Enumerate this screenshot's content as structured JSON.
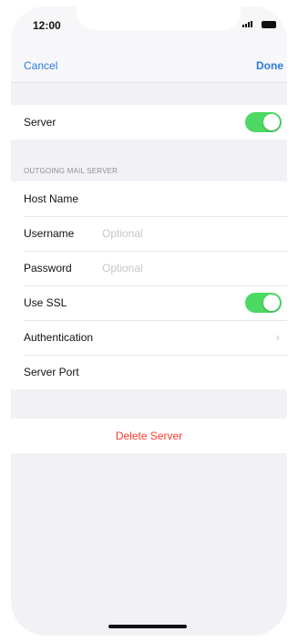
{
  "status_bar": {
    "time": "12:00"
  },
  "nav": {
    "cancel_label": "Cancel",
    "done_label": "Done"
  },
  "server_section": {
    "label": "Server",
    "enabled": true
  },
  "outgoing": {
    "header": "OUTGOING MAIL SERVER",
    "host_name_label": "Host Name",
    "username_label": "Username",
    "username_placeholder": "Optional",
    "password_label": "Password",
    "password_placeholder": "Optional",
    "use_ssl_label": "Use SSL",
    "use_ssl_enabled": true,
    "authentication_label": "Authentication",
    "server_port_label": "Server Port"
  },
  "delete_label": "Delete Server",
  "colors": {
    "accent": "#2a7be4",
    "toggle_on": "#4cd964",
    "destructive": "#ff3b30"
  }
}
